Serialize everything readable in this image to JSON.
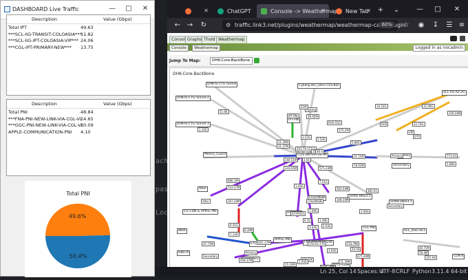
{
  "background_editor": {
    "code_fragments": [
      "ach s",
      "passw",
      "Local"
    ],
    "statusbar": {
      "position": "Ln 25, Col 14",
      "spaces": "Spaces: 4",
      "encoding": "UTF-8",
      "eol": "CRLF",
      "language": "Python",
      "interpreter": "3.11.4 64-bit"
    }
  },
  "dashboard": {
    "title": "DASHBOARD Live Traffic",
    "panel1": {
      "headers": [
        "Description",
        "Value (Gbps)"
      ],
      "rows": [
        {
          "desc": "Total IPT",
          "value": "49.63"
        },
        {
          "desc": "***SCL-IIG-TRANSIT-COLOASIA***",
          "value": "11.82"
        },
        {
          "desc": "***SCL-IIG-IPT-COLOASIA-VIP***",
          "value": "24.06"
        },
        {
          "desc": "***CGL-IPT-PRIMARY-NEW***",
          "value": "13.75"
        }
      ]
    },
    "panel2": {
      "headers": [
        "Description",
        "Value (Gbps)"
      ],
      "rows": [
        {
          "desc": "Total PNI",
          "value": "48.84"
        },
        {
          "desc": "***FNA-PNI-NEW-LINK-VIA-CGL-VL",
          "value": "24.65"
        },
        {
          "desc": "***GGC-PNI-NEW-LINK-VIA-CGL-VL",
          "value": "20.09"
        },
        {
          "desc": "APPLE-COMMUNICATION-PNI",
          "value": "4.10"
        }
      ]
    },
    "chart_data": {
      "type": "pie",
      "title": "Total PNI",
      "categories": [
        "",
        ""
      ],
      "values": [
        49.6,
        50.4
      ],
      "labels": [
        "49.6%",
        "50.4%"
      ],
      "colors": [
        "#ff7f0e",
        "#1f77b4"
      ]
    }
  },
  "browser": {
    "tabs": [
      {
        "label": "",
        "icon_color": "#ff7139"
      },
      {
        "label": "ChatGPT",
        "icon_color": "#10a37f"
      },
      {
        "label": "Console -> Weathermap",
        "icon_color": "#4caf50"
      },
      {
        "label": "New Tab",
        "icon_color": "#ff7139"
      }
    ],
    "url": "traffic.link3.net/plugins/weathermap/weathermap-cacti-plugin",
    "zoom": "60%",
    "cacti": {
      "tabs": [
        "Console",
        "Graphs",
        "Thold",
        "Weathermap"
      ],
      "crumbs": [
        "Console",
        "Weathermap"
      ],
      "logged_in": "Logged in as nocadmin",
      "jump_label": "Jump To Map:",
      "jump_value": "DHK-Core-BackBone",
      "map_title": "DHK-Core-BackBone",
      "nodes": [
        "DHK-To-CTG-Tunnel",
        "DHK-To-CTG-Tunnel-2",
        "DHK-To-CTG-Tunnel-3",
        "Cyberg.ate_(DEG-CES-BD)",
        "SCL-IIG-AZ.2G",
        "IPT-PNI",
        "Core-BKP-M-T04-9K",
        "Meeno_Guard",
        "Primary",
        "Secondary",
        "Altor",
        "CIL-CDN & APPLE-PNI",
        "ETL-CDN",
        "APPLE-PNI",
        "Secondary",
        "FNA-BKP-M-BD246",
        "DTYP055",
        "COLONSIB",
        "SONO-BKD3-2",
        "SONO-BKD3-1",
        "CGL-PNI",
        "DTCL-CDN",
        "GGC-PNI",
        "BNIX",
        "DBS-IX",
        "SCL_DSG-SE1",
        "CDN-6"
      ],
      "link_labels": [
        "51.6K",
        "1.10G",
        "11.39M",
        "Cyberg",
        "21M",
        "39.95M",
        "IPT-PNI",
        "RUS-55G",
        "575.2M",
        "14.53G",
        "11.09G",
        "156.56M",
        "RUS",
        "22.74G",
        "DTP",
        "VIP",
        "5.89G",
        "2.53G",
        "3.52G",
        "11.37M",
        "203.79.127.1",
        "25.97M",
        "31.1SM",
        "Primary",
        "773.03",
        "1.98G",
        "78.63M",
        "46.9",
        "144.51M",
        "333.65M",
        "2.05",
        "575.33M",
        "886.1M",
        "519.37M",
        "307.29M",
        "1.4SG",
        "7.51G",
        "562.04M",
        "381.01",
        "COLONSIB",
        "348.59M",
        "1.69G",
        "Secondary",
        "3.06G",
        "Altor",
        "DTYP055",
        "6.1G",
        "3.43G",
        "1.48G",
        "2.03G",
        "4.41G",
        "8.39M",
        "7.13G",
        "601.17M",
        "3.93G",
        "250.62.276",
        "CGL-PNI",
        "20.44",
        "675.39M",
        "929.5M",
        "11.39M",
        "40.75M",
        "58.4M",
        "197.90",
        "458.37M",
        "15.10M",
        "1.93G",
        "47.73M",
        "Secondary",
        "Primary"
      ]
    }
  }
}
